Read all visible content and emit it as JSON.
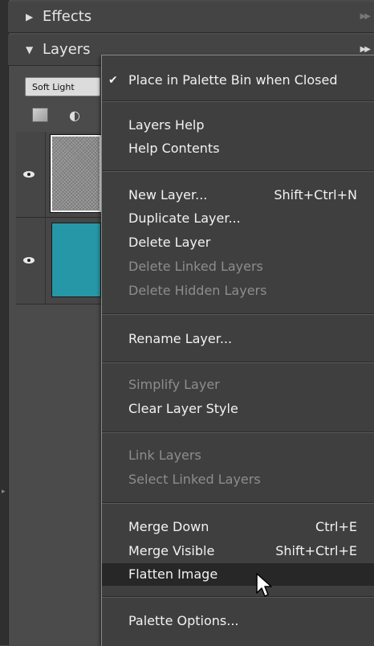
{
  "palettes": {
    "effects": {
      "title": "Effects"
    },
    "layers": {
      "title": "Layers",
      "blend_mode": "Soft Light"
    }
  },
  "context_menu": {
    "items": [
      {
        "label": "Place in Palette Bin when Closed",
        "shortcut": "",
        "checked": true,
        "disabled": false
      },
      {
        "label": "Layers Help",
        "shortcut": "",
        "disabled": false
      },
      {
        "label": "Help Contents",
        "shortcut": "",
        "disabled": false
      },
      {
        "label": "New Layer...",
        "shortcut": "Shift+Ctrl+N",
        "disabled": false
      },
      {
        "label": "Duplicate Layer...",
        "shortcut": "",
        "disabled": false
      },
      {
        "label": "Delete Layer",
        "shortcut": "",
        "disabled": false
      },
      {
        "label": "Delete Linked Layers",
        "shortcut": "",
        "disabled": true
      },
      {
        "label": "Delete Hidden Layers",
        "shortcut": "",
        "disabled": true
      },
      {
        "label": "Rename Layer...",
        "shortcut": "",
        "disabled": false
      },
      {
        "label": "Simplify Layer",
        "shortcut": "",
        "disabled": true
      },
      {
        "label": "Clear Layer Style",
        "shortcut": "",
        "disabled": false
      },
      {
        "label": "Link Layers",
        "shortcut": "",
        "disabled": true
      },
      {
        "label": "Select Linked Layers",
        "shortcut": "",
        "disabled": true
      },
      {
        "label": "Merge Down",
        "shortcut": "Ctrl+E",
        "disabled": false
      },
      {
        "label": "Merge Visible",
        "shortcut": "Shift+Ctrl+E",
        "disabled": false
      },
      {
        "label": "Flatten Image",
        "shortcut": "",
        "disabled": false,
        "highlighted": true
      },
      {
        "label": "Palette Options...",
        "shortcut": "",
        "disabled": false
      }
    ],
    "check_mark": "✔"
  },
  "layer_thumb_colors": [
    "#8c8c8c",
    "#2697a6"
  ],
  "icons": [
    "triangle-right-icon",
    "triangle-down-icon",
    "palette-more-icon",
    "eye-icon",
    "new-layer-icon",
    "adjustment-layer-icon",
    "mouse-pointer-icon"
  ]
}
